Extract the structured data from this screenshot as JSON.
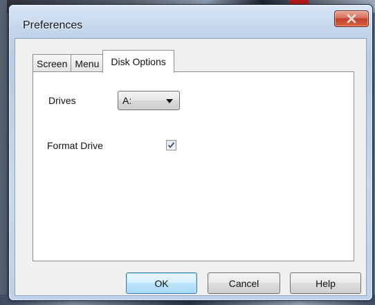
{
  "window": {
    "title": "Preferences",
    "close_icon": "close-x-icon"
  },
  "tabs": [
    {
      "label": "Screen",
      "selected": false
    },
    {
      "label": "Menu",
      "selected": false
    },
    {
      "label": "Disk Options",
      "selected": true
    }
  ],
  "disk_options": {
    "drives_label": "Drives",
    "drive_value": "A:",
    "format_label": "Format Drive",
    "format_checked": true
  },
  "buttons": {
    "ok_label": "OK",
    "cancel_label": "Cancel",
    "help_label": "Help"
  },
  "colors": {
    "close_button": "#c2442b",
    "default_button_border": "#3c7fb1"
  }
}
